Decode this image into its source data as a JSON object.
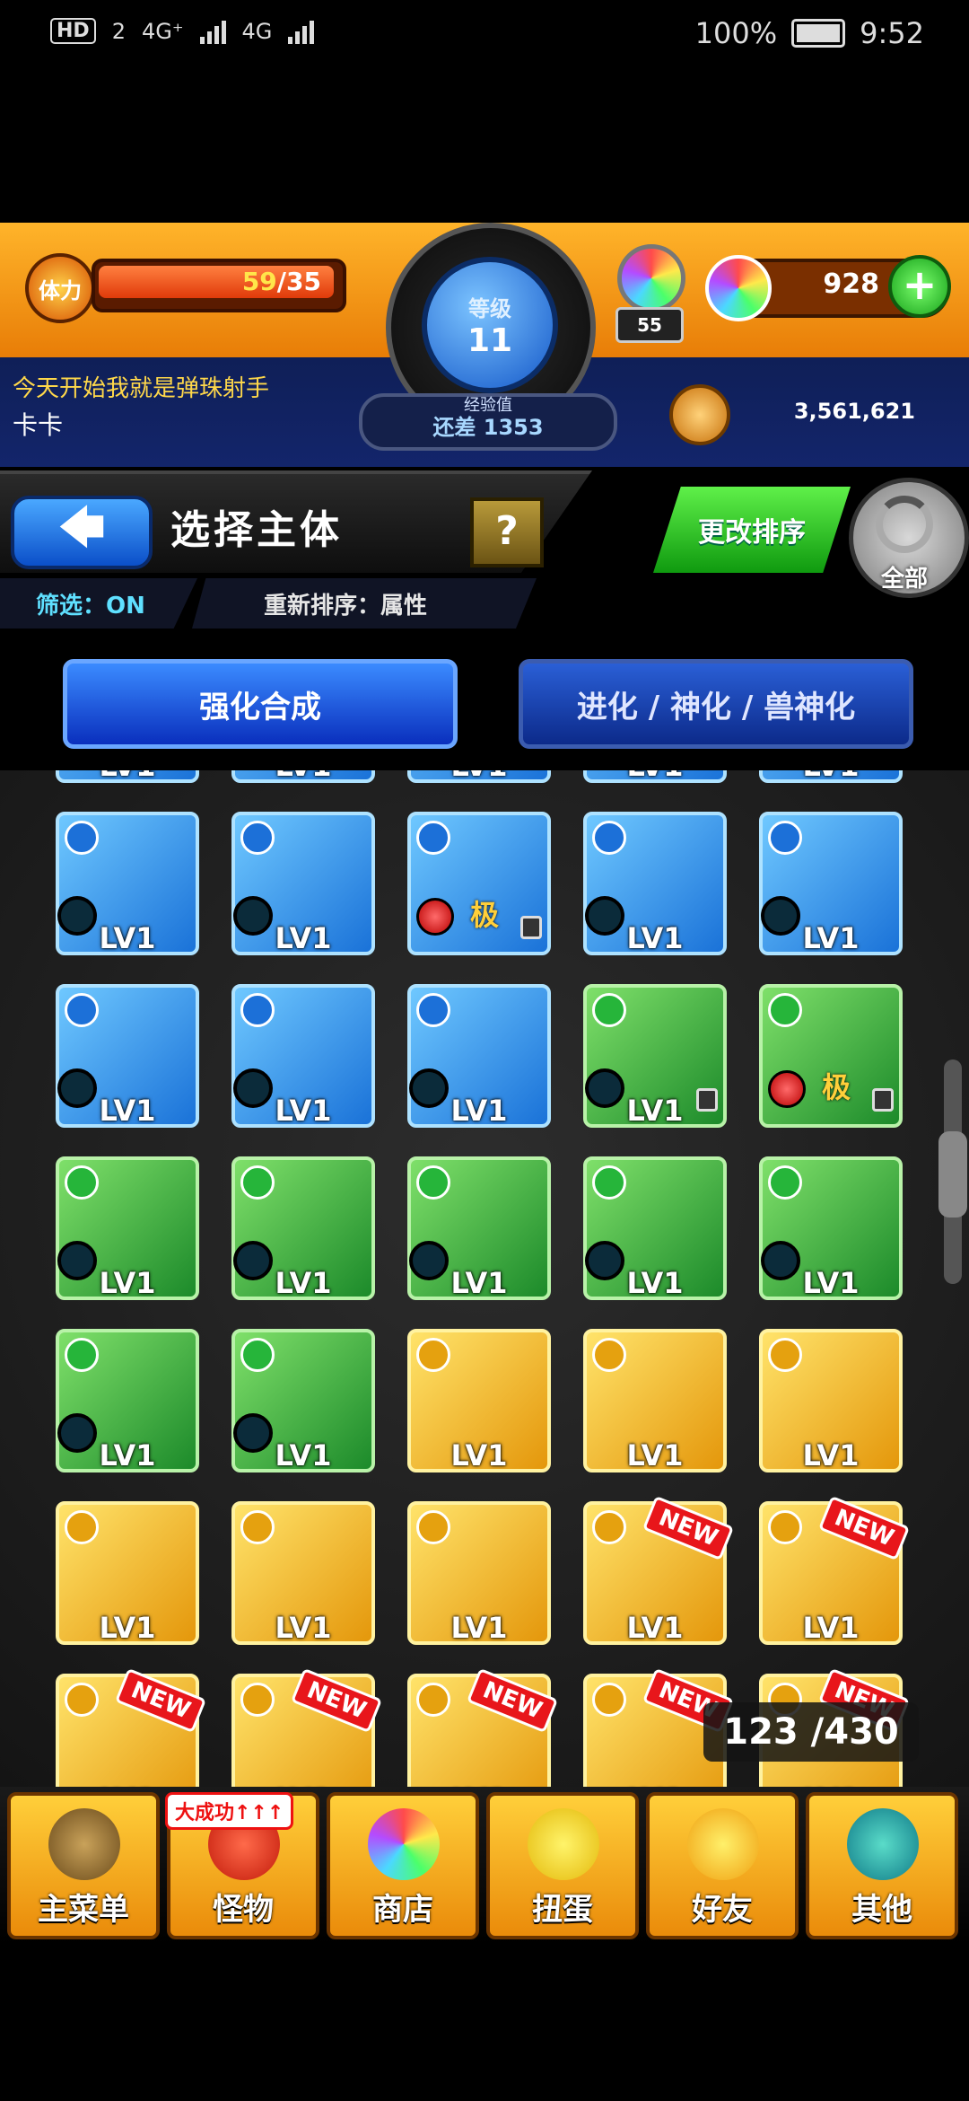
{
  "status_bar": {
    "hd": "HD",
    "sim": "2",
    "net1": "4G⁺",
    "net2": "4G",
    "battery": "100%",
    "time": "9:52"
  },
  "header": {
    "stamina_label": "体力",
    "stamina_current": "59",
    "stamina_max": "/35",
    "rank_label": "等级",
    "rank_value": "11",
    "exp_label": "经验值",
    "exp_remaining": "还差 1353",
    "orb_stock": "55",
    "orb_count": "928",
    "plus": "+",
    "player_title": "今天开始我就是弹珠射手",
    "player_name": "卡卡",
    "coins": "3,561,621"
  },
  "toolbar": {
    "back_arrow": "🡄",
    "screen_title": "选择主体",
    "help": "?",
    "filter": "筛选：ON",
    "resort": "重新排序：属性",
    "change_sort": "更改排序",
    "all": "全部"
  },
  "tabs": {
    "strengthen": "强化合成",
    "evolve": "进化 / 神化 / 兽神化"
  },
  "grid": {
    "lv_label": "LV1",
    "ex_label": "极",
    "new_label": "NEW",
    "counter": "123 /430",
    "rows": [
      [
        "water",
        "water",
        "water",
        "water",
        "water"
      ],
      [
        "water",
        "water",
        "water",
        "wood",
        "wood"
      ],
      [
        "wood",
        "wood",
        "wood",
        "wood",
        "wood"
      ],
      [
        "wood",
        "wood",
        "light",
        "light",
        "light"
      ],
      [
        "light",
        "light",
        "light",
        "light",
        "light"
      ],
      [
        "light",
        "light",
        "light",
        "light",
        "light"
      ]
    ],
    "icon_elements": [
      "water-element-icon",
      "wood-element-icon",
      "light-element-icon"
    ]
  },
  "bottom_nav": {
    "badge": "大成功↑↑↑",
    "items": [
      "主菜单",
      "怪物",
      "商店",
      "扭蛋",
      "好友",
      "其他"
    ]
  }
}
